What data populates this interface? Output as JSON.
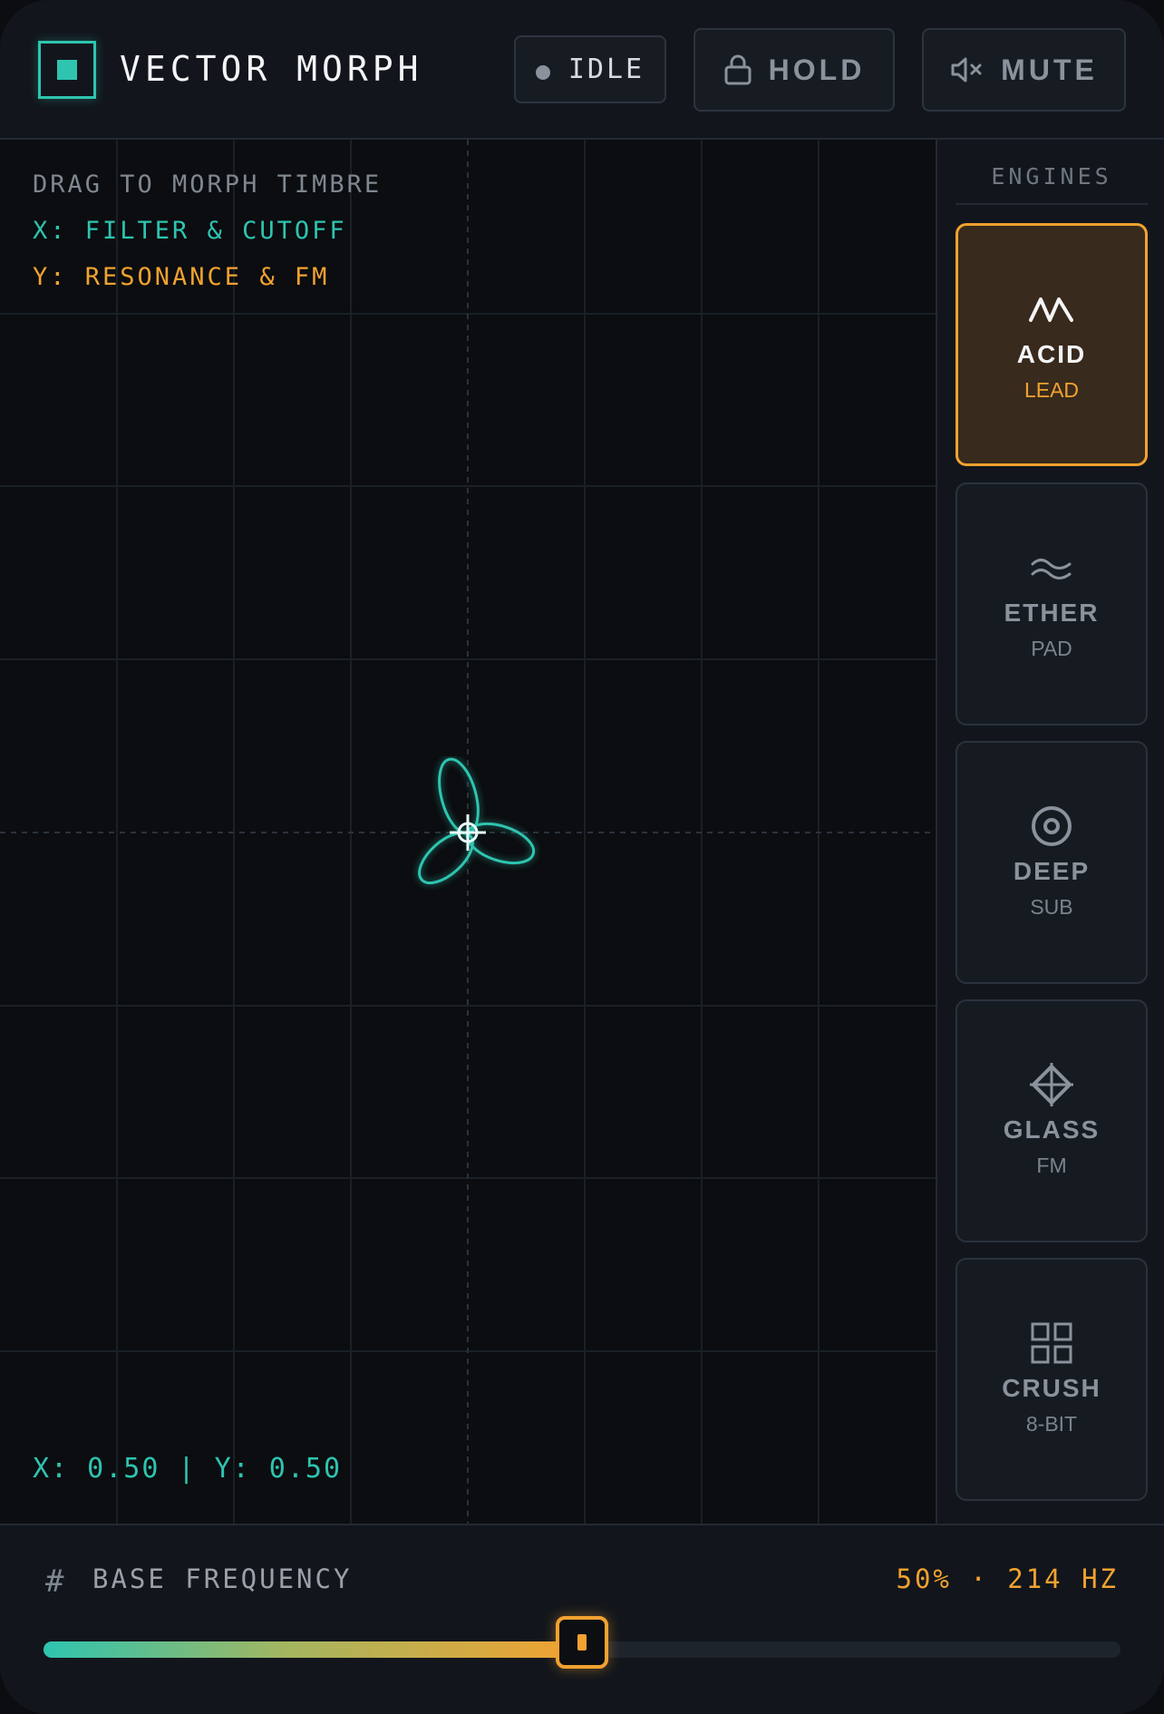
{
  "header": {
    "title": "VECTOR MORPH",
    "status_label": "IDLE",
    "hold_label": "HOLD",
    "mute_label": "MUTE"
  },
  "pad": {
    "hint": "DRAG TO MORPH TIMBRE",
    "x_hint": "X: FILTER & CUTOFF",
    "y_hint": "Y: RESONANCE & FM",
    "x_value": 0.5,
    "y_value": 0.5,
    "coords": "X: 0.50 | Y: 0.50"
  },
  "sidebar": {
    "title": "ENGINES",
    "engines": [
      {
        "name": "ACID",
        "sub": "LEAD",
        "icon": "zigzag-icon",
        "active": true
      },
      {
        "name": "ETHER",
        "sub": "PAD",
        "icon": "wave-icon",
        "active": false
      },
      {
        "name": "DEEP",
        "sub": "SUB",
        "icon": "target-icon",
        "active": false
      },
      {
        "name": "GLASS",
        "sub": "FM",
        "icon": "crosshair-diamond-icon",
        "active": false
      },
      {
        "name": "CRUSH",
        "sub": "8-BIT",
        "icon": "grid-icon",
        "active": false
      }
    ]
  },
  "footer": {
    "label": "BASE FREQUENCY",
    "value": "50% · 214 HZ",
    "slider_fraction": 0.5
  },
  "colors": {
    "teal_accent": "#2ec4b0",
    "orange_accent": "#f2a230",
    "background": "#0c0e12",
    "panel": "#12161c"
  }
}
